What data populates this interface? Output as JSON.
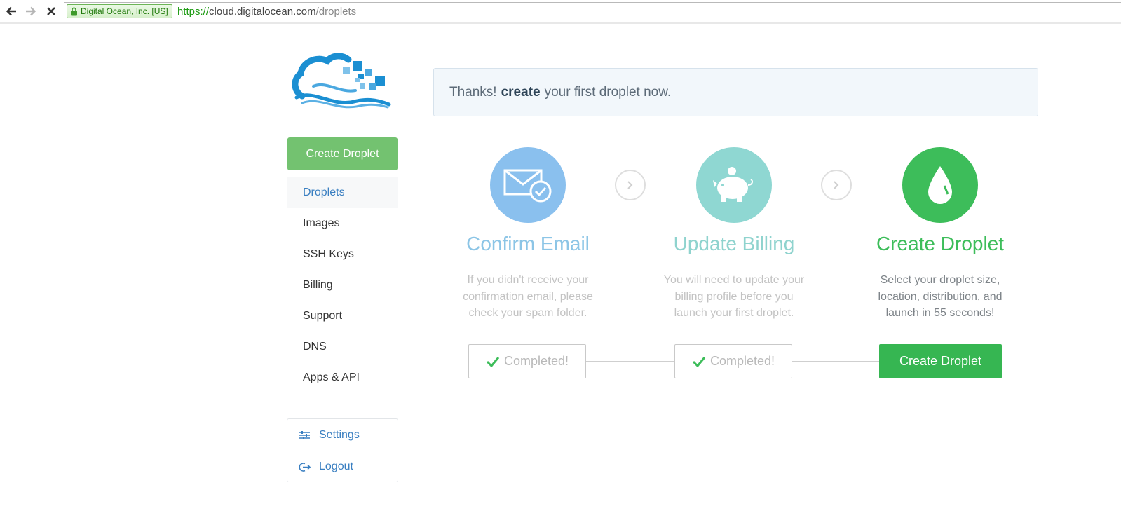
{
  "browser": {
    "ev_label": "Digital Ocean, Inc. [US]",
    "url_scheme": "https://",
    "url_host": "cloud.digitalocean.com",
    "url_path": "/droplets"
  },
  "sidebar": {
    "create_button": "Create Droplet",
    "items": [
      {
        "label": "Droplets"
      },
      {
        "label": "Images"
      },
      {
        "label": "SSH Keys"
      },
      {
        "label": "Billing"
      },
      {
        "label": "Support"
      },
      {
        "label": "DNS"
      },
      {
        "label": "Apps & API"
      }
    ],
    "settings_label": "Settings",
    "logout_label": "Logout"
  },
  "banner": {
    "prefix": "Thanks!",
    "emphasis": "create",
    "suffix": "your first droplet now."
  },
  "steps": [
    {
      "title": "Confirm Email",
      "desc": "If you didn't receive your confirmation email, please check your spam folder.",
      "button": "Completed!",
      "icon": "envelope-check-icon"
    },
    {
      "title": "Update Billing",
      "desc": "You will need to update your billing profile before you launch your first droplet.",
      "button": "Completed!",
      "icon": "piggy-bank-icon"
    },
    {
      "title": "Create Droplet",
      "desc": "Select your droplet size, location, distribution, and launch in 55 seconds!",
      "button": "Create Droplet",
      "icon": "droplet-icon"
    }
  ],
  "colors": {
    "step1": "#8ac0ee",
    "step2": "#8fd7d2",
    "step3": "#3dbd5a",
    "link": "#3a7fc1",
    "sidebar_button": "#73c270"
  }
}
